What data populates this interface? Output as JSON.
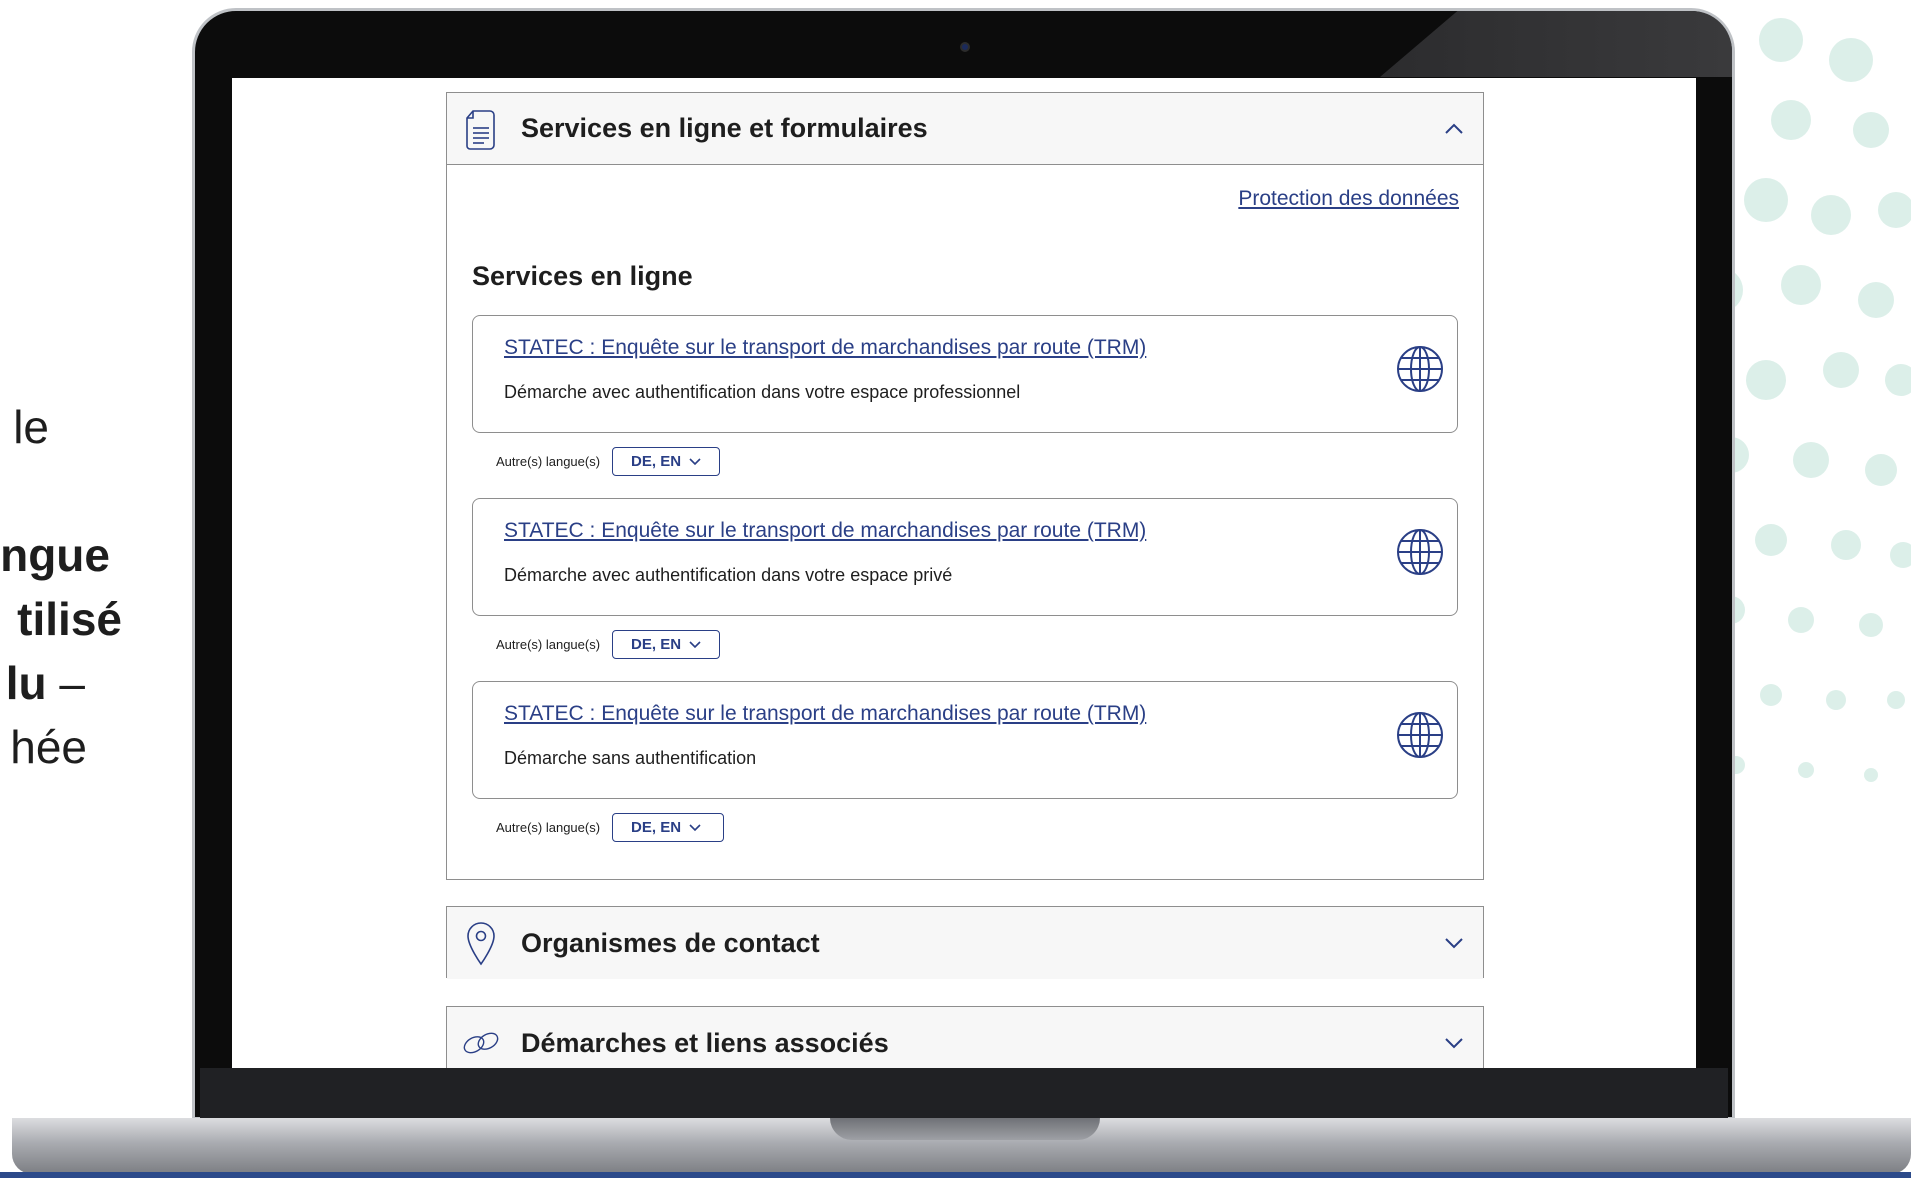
{
  "slide": {
    "lines": [
      "le",
      "",
      "ngue",
      "tilisé",
      "lu –",
      "hée"
    ]
  },
  "panels": {
    "services": {
      "title": "Services en ligne et formulaires",
      "icon": "document-icon",
      "chevron": "chevron-up-icon",
      "protection_link": "Protection des données",
      "section_title": "Services en ligne",
      "items": [
        {
          "link": "STATEC : Enquête sur le transport de marchandises par route (TRM)",
          "desc": "Démarche avec authentification dans votre espace professionnel",
          "lang_label": "Autre(s) langue(s)",
          "langs": "DE, EN",
          "icon": "globe-icon"
        },
        {
          "link": "STATEC : Enquête sur le transport de marchandises par route (TRM)",
          "desc": "Démarche avec authentification dans votre espace privé",
          "lang_label": "Autre(s) langue(s)",
          "langs": "DE, EN",
          "icon": "globe-icon"
        },
        {
          "link": "STATEC : Enquête sur le transport de marchandises par route (TRM)",
          "desc": "Démarche sans authentification",
          "lang_label": "Autre(s) langue(s)",
          "langs": "DE, EN",
          "icon": "globe-icon"
        }
      ]
    },
    "contacts": {
      "title": "Organismes de contact",
      "icon": "location-pin-icon",
      "chevron": "chevron-down-icon"
    },
    "related": {
      "title": "Démarches et liens associés",
      "icon": "link-icon",
      "chevron": "chevron-down-icon"
    }
  },
  "colors": {
    "link": "#2a3f86",
    "border": "#8e8e8e",
    "dots": "#d8ebe6"
  }
}
